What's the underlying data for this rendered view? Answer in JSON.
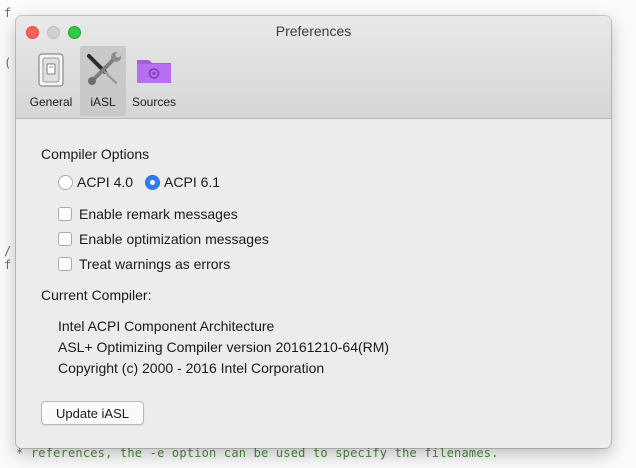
{
  "window": {
    "title": "Preferences"
  },
  "toolbar": {
    "items": [
      {
        "label": "General",
        "icon": "switch-icon",
        "selected": false
      },
      {
        "label": "iASL",
        "icon": "tools-icon",
        "selected": true
      },
      {
        "label": "Sources",
        "icon": "folder-icon",
        "selected": false
      }
    ]
  },
  "compiler_options": {
    "heading": "Compiler Options",
    "acpi_versions": [
      {
        "label": "ACPI 4.0",
        "selected": false
      },
      {
        "label": "ACPI 6.1",
        "selected": true
      }
    ],
    "checkboxes": [
      {
        "label": "Enable remark messages",
        "checked": false
      },
      {
        "label": "Enable optimization messages",
        "checked": false
      },
      {
        "label": "Treat warnings as errors",
        "checked": false
      }
    ]
  },
  "current_compiler": {
    "heading": "Current Compiler:",
    "lines": [
      "Intel ACPI Component Architecture",
      "ASL+ Optimizing Compiler version 20161210-64(RM)",
      "Copyright (c) 2000 - 2016 Intel Corporation"
    ]
  },
  "update_button": {
    "label": "Update iASL"
  },
  "background": {
    "code_line": "* references, the -e option can be used to specify the filenames."
  },
  "colors": {
    "accent": "#2f7df6",
    "close": "#fc605b",
    "zoom": "#34c84a",
    "sources_folder": "#b067e8",
    "code_text": "#4a8a3e"
  }
}
